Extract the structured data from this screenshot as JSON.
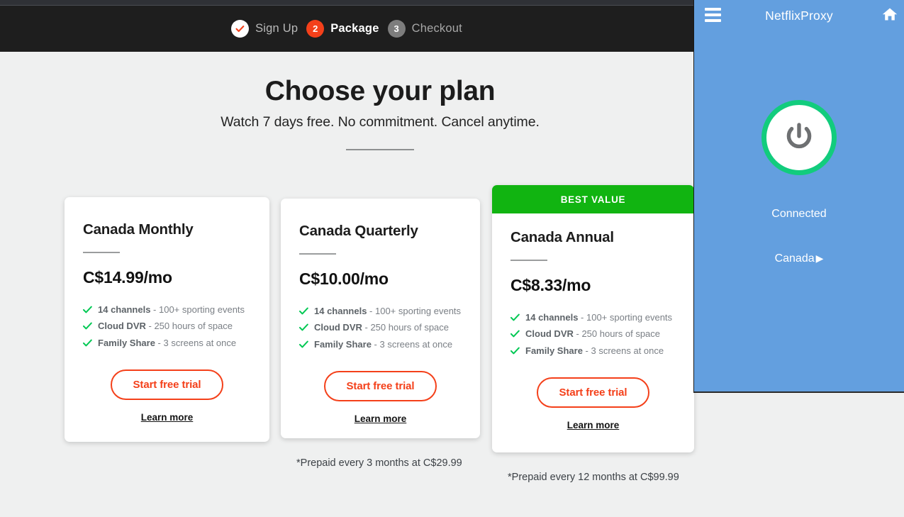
{
  "colors": {
    "page_bg": "#eff0f0",
    "topbar_bg": "#1e1e1e",
    "accent_orange": "#f4401a",
    "best_value_green": "#11b411",
    "check_green": "#00c853",
    "vpn_panel_blue": "#639fdf",
    "power_ring_green": "#12cc7d",
    "card_bg": "#ffffff"
  },
  "topbar": {
    "steps": [
      {
        "badge": "check-icon",
        "label": "Sign Up",
        "state": "done"
      },
      {
        "badge": "2",
        "label": "Package",
        "state": "active"
      },
      {
        "badge": "3",
        "label": "Checkout",
        "state": "todo"
      }
    ]
  },
  "header": {
    "title": "Choose your plan",
    "subtitle": "Watch 7 days free. No commitment. Cancel anytime."
  },
  "plans": [
    {
      "badge": null,
      "title": "Canada Monthly",
      "price": "C$14.99",
      "period": "/mo",
      "features": [
        {
          "strong": "14 channels",
          "rest": " - 100+ sporting events"
        },
        {
          "strong": "Cloud DVR",
          "rest": " - 250 hours of space"
        },
        {
          "strong": "Family Share",
          "rest": " - 3 screens at once"
        }
      ],
      "cta_label": "Start free trial",
      "learn_more_label": "Learn more",
      "prepaid_note": null
    },
    {
      "badge": null,
      "title": "Canada Quarterly",
      "price": "C$10.00",
      "period": "/mo",
      "features": [
        {
          "strong": "14 channels",
          "rest": " - 100+ sporting events"
        },
        {
          "strong": "Cloud DVR",
          "rest": " - 250 hours of space"
        },
        {
          "strong": "Family Share",
          "rest": " - 3 screens at once"
        }
      ],
      "cta_label": "Start free trial",
      "learn_more_label": "Learn more",
      "prepaid_note": "*Prepaid every 3 months at C$29.99"
    },
    {
      "badge": "BEST VALUE",
      "title": "Canada Annual",
      "price": "C$8.33",
      "period": "/mo",
      "features": [
        {
          "strong": "14 channels",
          "rest": " - 100+ sporting events"
        },
        {
          "strong": "Cloud DVR",
          "rest": " - 250 hours of space"
        },
        {
          "strong": "Family Share",
          "rest": " - 3 screens at once"
        }
      ],
      "cta_label": "Start free trial",
      "learn_more_label": "Learn more",
      "prepaid_note": "*Prepaid every 12 months at C$99.99"
    }
  ],
  "vpn": {
    "title": "NetflixProxy",
    "menu_icon": "hamburger-icon",
    "home_icon": "home-icon",
    "power_icon": "power-icon",
    "status": "Connected",
    "country": "Canada",
    "country_arrow": "▶"
  }
}
